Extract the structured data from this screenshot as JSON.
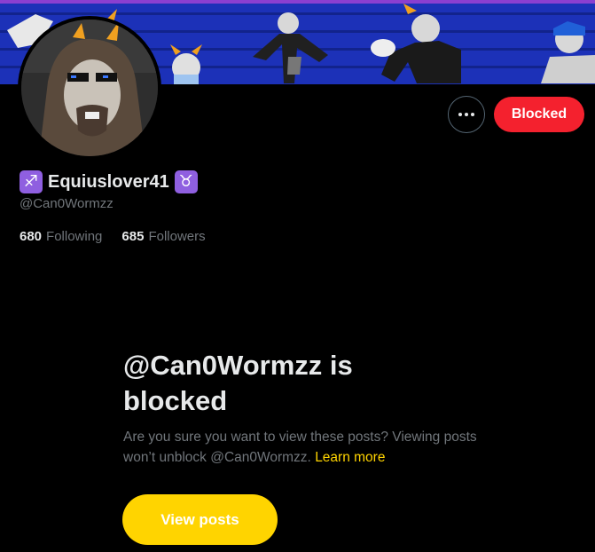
{
  "profile": {
    "display_name": "Equiuslover41",
    "left_emoji": "♐",
    "right_emoji": "♉",
    "handle": "@Can0Wormzz"
  },
  "actions": {
    "more_icon": "more-horizontal-icon",
    "blocked_label": "Blocked"
  },
  "stats": {
    "following_count": "680",
    "following_label": "Following",
    "followers_count": "685",
    "followers_label": "Followers"
  },
  "blocked_notice": {
    "title": "@Can0Wormzz is blocked",
    "body": "Are you sure you want to view these posts? Viewing posts won’t unblock @Can0Wormzz.",
    "learn_more": "Learn more",
    "view_posts": "View posts"
  },
  "colors": {
    "background": "#000000",
    "blocked_red": "#f4212e",
    "accent_yellow": "#ffd400",
    "banner_blue": "#1a2fb8",
    "zodiac_purple": "#8f5fe0"
  }
}
